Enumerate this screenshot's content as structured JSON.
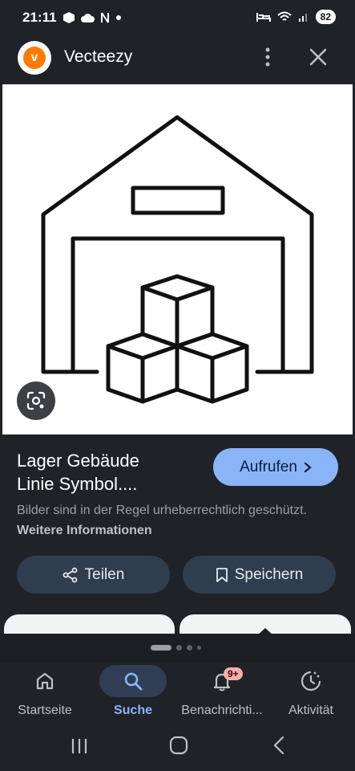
{
  "status_bar": {
    "time": "21:11",
    "battery": "82"
  },
  "header": {
    "app_name": "Vecteezy",
    "logo_letter": "v"
  },
  "result": {
    "title_line1": "Lager Gebäude",
    "title_line2": "Linie Symbol....",
    "open_label": "Aufrufen",
    "copyright_text": "Bilder sind in der Regel urheberrechtlich geschützt.",
    "copyright_link": "Weitere Informationen"
  },
  "actions": {
    "share_label": "Teilen",
    "save_label": "Speichern"
  },
  "bottom_nav": {
    "items": [
      {
        "label": "Startseite",
        "icon": "home-icon"
      },
      {
        "label": "Suche",
        "icon": "search-icon",
        "active": true
      },
      {
        "label": "Benachrichti...",
        "icon": "bell-icon",
        "badge": "9+"
      },
      {
        "label": "Aktivität",
        "icon": "activity-icon"
      }
    ]
  },
  "colors": {
    "background": "#1f2328",
    "accent": "#8ab4f8",
    "pill": "#2e3e4e",
    "brand_orange": "#ff7a00"
  }
}
